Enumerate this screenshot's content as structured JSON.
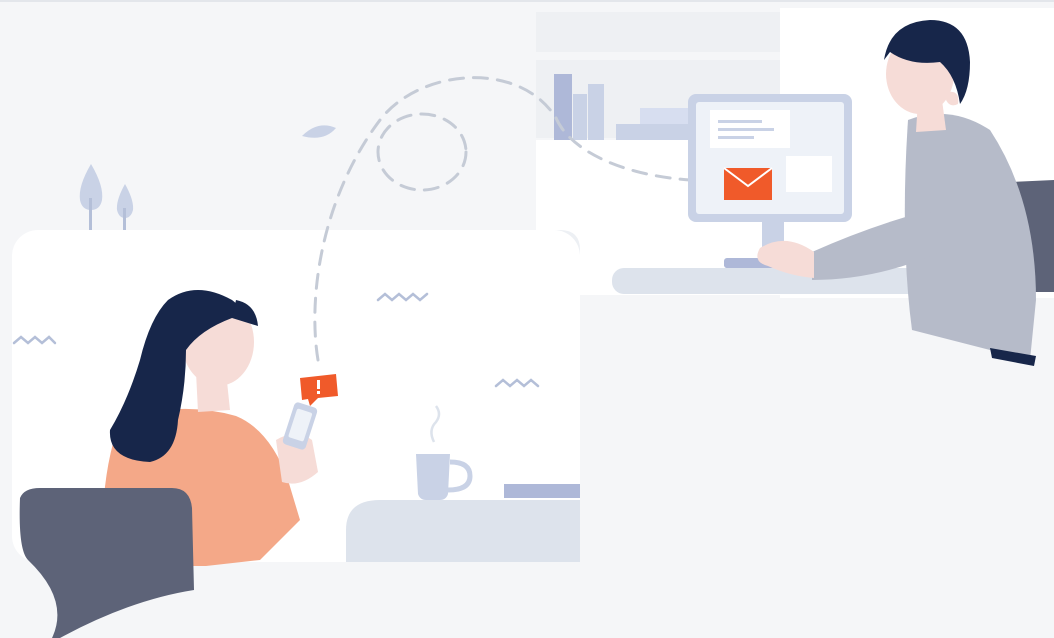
{
  "illustration": {
    "palette": {
      "background": "#f5f6f8",
      "panel": "#ffffff",
      "light_panel": "#edf0f4",
      "navy_hair": "#17264a",
      "skin": "#f6dcd7",
      "orange_accent": "#f05a2a",
      "sweater_peach": "#f4a888",
      "shirt_grey": "#b6bbc9",
      "chair_slate": "#5d6378",
      "pale_blue": "#c9d2e6",
      "bar_blue": "#aeb8d8",
      "desk": "#dde3ec",
      "dashes": "#c5cbd6"
    },
    "icons": [
      "envelope-icon",
      "alert-icon",
      "phone-icon",
      "leaf-icon",
      "tree-icon",
      "coffee-mug-icon",
      "monitor-icon",
      "keyboard-icon"
    ]
  }
}
